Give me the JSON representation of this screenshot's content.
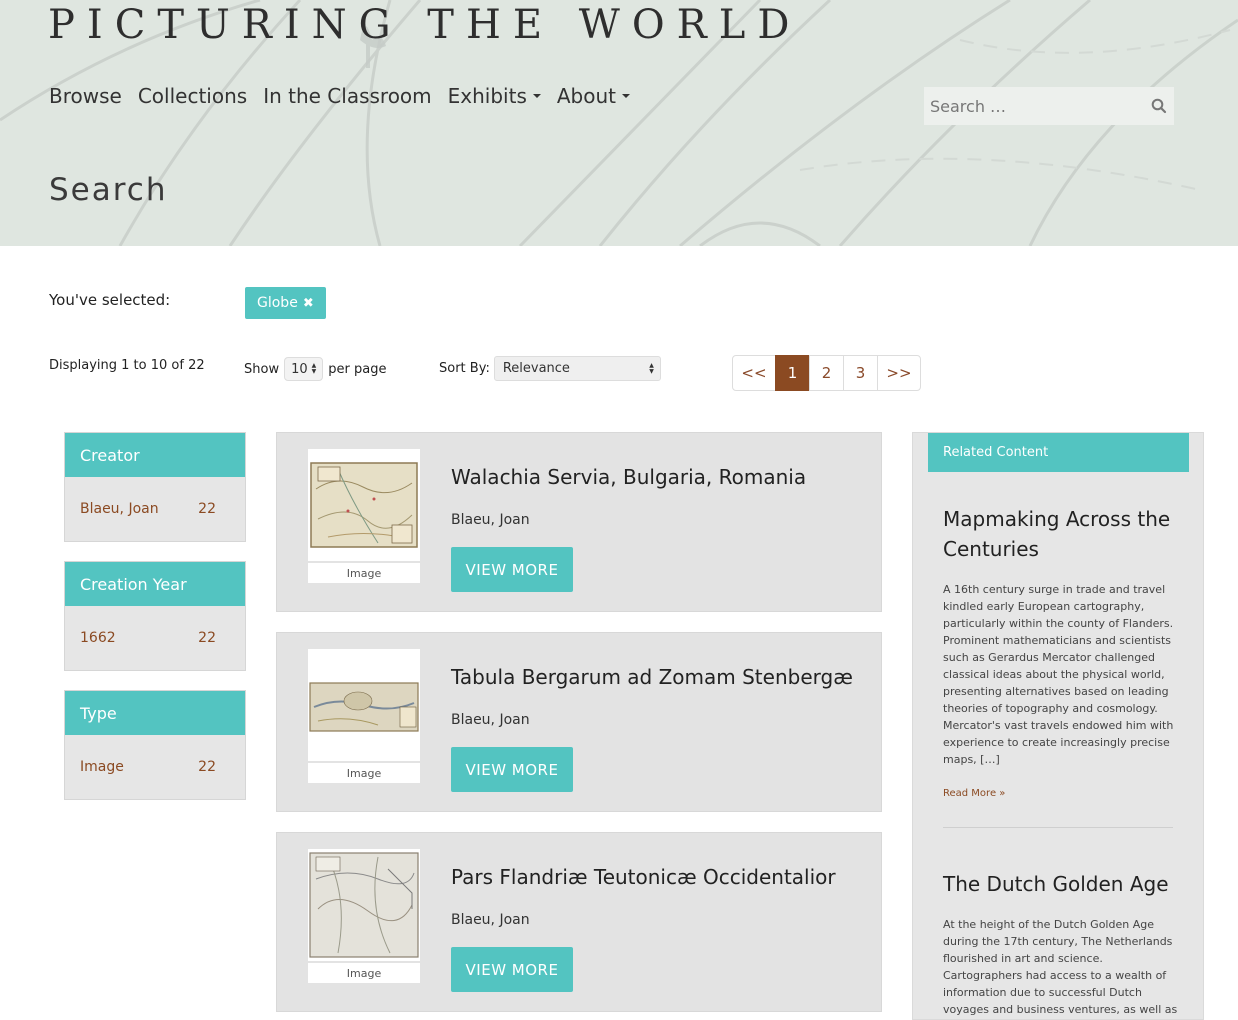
{
  "site": {
    "title": "PICTURING THE WORLD"
  },
  "nav": {
    "items": [
      {
        "label": "Browse"
      },
      {
        "label": "Collections"
      },
      {
        "label": "In the Classroom"
      },
      {
        "label": "Exhibits"
      },
      {
        "label": "About"
      }
    ]
  },
  "search": {
    "placeholder": "Search …"
  },
  "page": {
    "heading": "Search"
  },
  "selection": {
    "label": "You've selected:",
    "facet": "Globe"
  },
  "results_info": {
    "displaying": "Displaying 1 to 10 of 22",
    "show_label": "Show",
    "per_page_value": "10",
    "per_page_label": "per page",
    "sort_label": "Sort By:",
    "sort_value": "Relevance"
  },
  "pagination": {
    "prev": "<<",
    "pages": [
      "1",
      "2",
      "3"
    ],
    "next": ">>",
    "current": "1"
  },
  "facets": [
    {
      "title": "Creator",
      "value": "Blaeu, Joan",
      "count": "22"
    },
    {
      "title": "Creation Year",
      "value": "1662",
      "count": "22"
    },
    {
      "title": "Type",
      "value": "Image",
      "count": "22"
    }
  ],
  "results": [
    {
      "title": "Walachia Servia, Bulgaria, Romania",
      "creator": "Blaeu, Joan",
      "type": "Image",
      "button": "VIEW MORE"
    },
    {
      "title": "Tabula Bergarum ad Zomam Stenbergæ",
      "creator": "Blaeu, Joan",
      "type": "Image",
      "button": "VIEW MORE"
    },
    {
      "title": "Pars Flandriæ Teutonicæ Occidentalior",
      "creator": "Blaeu, Joan",
      "type": "Image",
      "button": "VIEW MORE"
    }
  ],
  "related": {
    "heading": "Related Content",
    "articles": [
      {
        "title": "Mapmaking Across the Centuries",
        "body": "A 16th century surge in trade and travel kindled early European cartography, particularly within the county of Flanders. Prominent mathematicians and scientists such as Gerardus Mercator challenged classical ideas about the physical world, presenting alternatives based on leading theories of topography and cosmology. Mercator's vast travels endowed him with experience to create increasingly precise maps, […]",
        "more": "Read More »"
      },
      {
        "title": "The Dutch Golden Age",
        "body": "At the height of the Dutch Golden Age during the 17th century, The Netherlands flourished in art and science. Cartographers had access to a wealth of information due to successful Dutch voyages and business ventures, as well as impressive Flemish"
      }
    ]
  },
  "colors": {
    "accent": "#53c4c1",
    "link": "#8b4a22",
    "panel": "#e3e3e3"
  }
}
